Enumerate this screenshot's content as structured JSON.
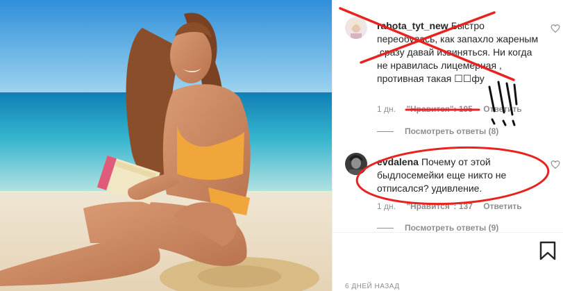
{
  "comments": [
    {
      "username": "rabota_tyt_new",
      "text": "Быстро переобулась, как запахло жареным .сразу давай извиняться. Ни когда не нравилась лицемерная , противная такая ☐☐фу",
      "time": "1 дн.",
      "likes": "\"Нравится\": 195",
      "reply": "Ответить",
      "view_replies": "Посмотреть ответы (8)"
    },
    {
      "username": "evdalena",
      "text": "Почему от этой быдлосемейки еще никто не отписался? удивление.",
      "time": "1 дн.",
      "likes": "\"Нравится\": 137",
      "reply": "Ответить",
      "view_replies": "Посмотреть ответы (9)"
    }
  ],
  "post": {
    "timestamp": "6 ДНЕЙ НАЗАД"
  },
  "icons": [
    "heart-icon",
    "bookmark-icon"
  ],
  "colors": {
    "annotation_red": "#e8231f",
    "secondary_text": "#8e8e8e",
    "primary_text": "#262626",
    "sea": "#2aa6c9",
    "sand": "#efe1c8",
    "swimsuit": "#f0a63a"
  }
}
